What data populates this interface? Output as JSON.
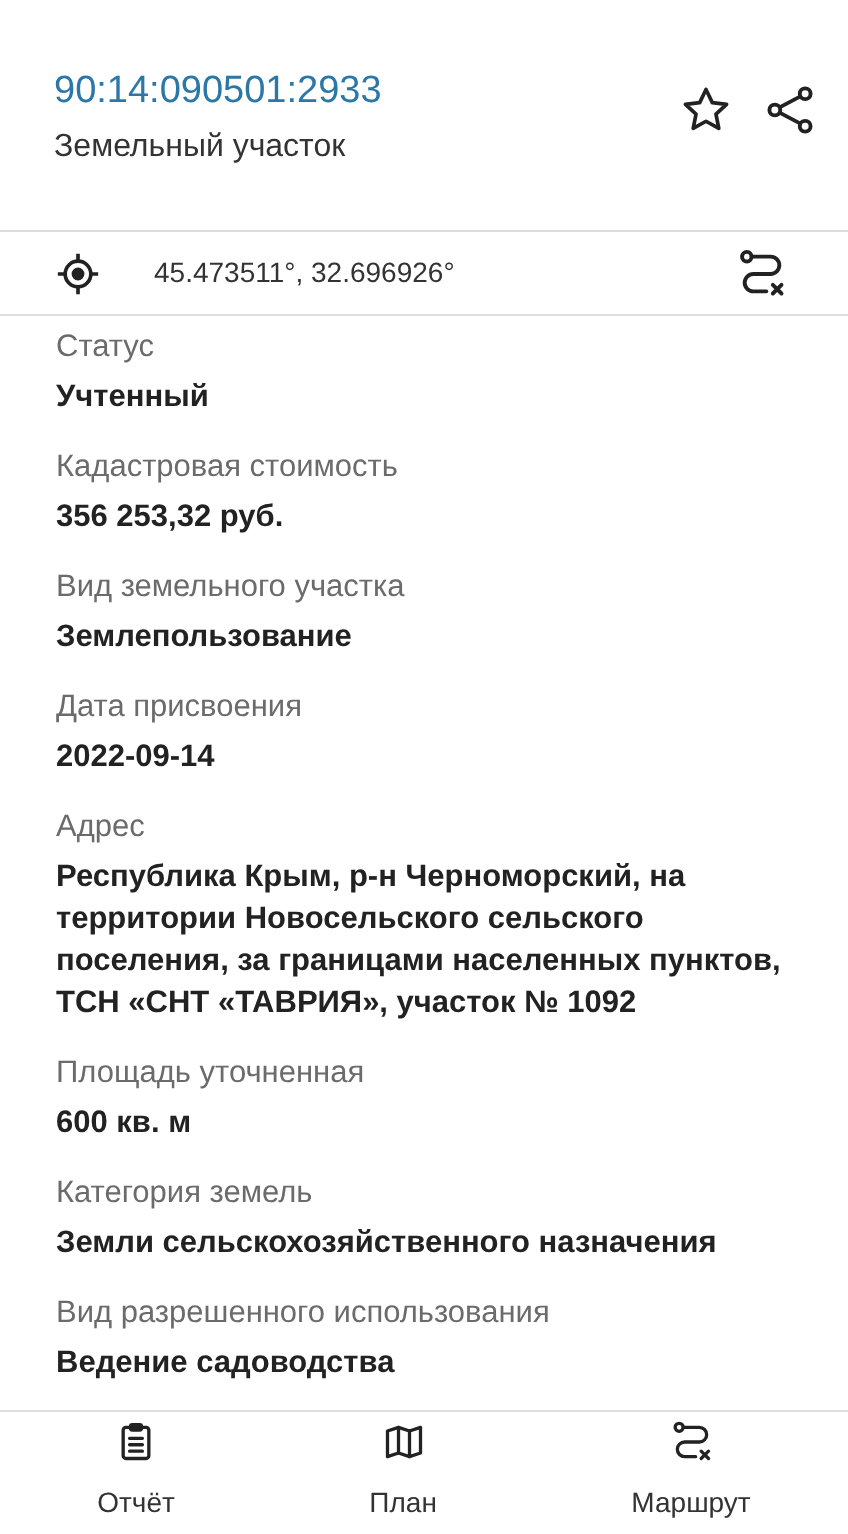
{
  "header": {
    "title": "90:14:090501:2933",
    "subtitle": "Земельный участок"
  },
  "coordinates": "45.473511°, 32.696926°",
  "fields": [
    {
      "label": "Статус",
      "value": "Учтенный"
    },
    {
      "label": "Кадастровая стоимость",
      "value": "356 253,32 руб."
    },
    {
      "label": "Вид земельного участка",
      "value": "Землепользование"
    },
    {
      "label": "Дата присвоения",
      "value": "2022-09-14"
    },
    {
      "label": "Адрес",
      "value": "Республика Крым, р-н Черноморский, на территории Новосельского сельского поселения, за границами населенных пунктов, ТСН «СНТ «ТАВРИЯ», участок № 1092"
    },
    {
      "label": "Площадь уточненная",
      "value": "600 кв. м"
    },
    {
      "label": "Категория земель",
      "value": "Земли сельскохозяйственного назначения"
    },
    {
      "label": "Вид разрешенного использования",
      "value": "Ведение садоводства"
    }
  ],
  "bottom_nav": [
    {
      "kind": "report",
      "label": "Отчёт"
    },
    {
      "kind": "plan",
      "label": "План"
    },
    {
      "kind": "route",
      "label": "Маршрут"
    }
  ]
}
